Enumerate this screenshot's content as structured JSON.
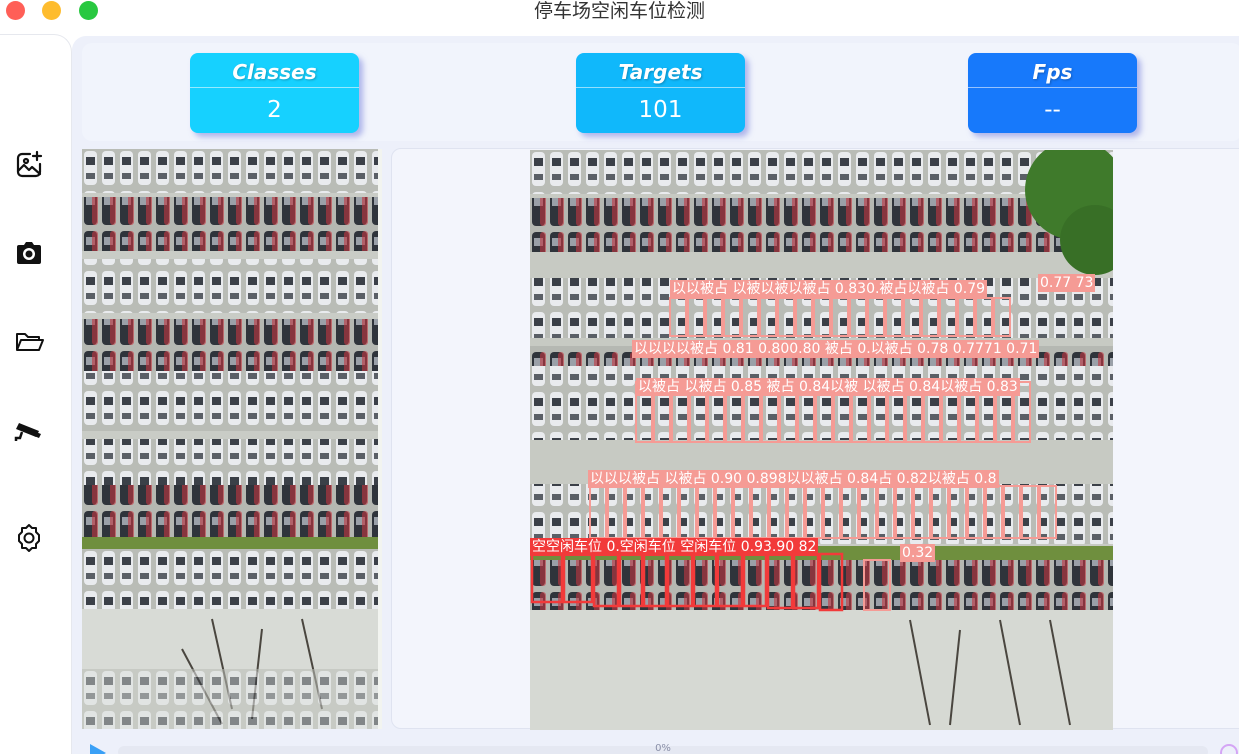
{
  "window": {
    "title": "停车场空闲车位检测"
  },
  "sidebar": {
    "items": [
      {
        "name": "add-image",
        "icon": "image-add-icon"
      },
      {
        "name": "camera",
        "icon": "camera-icon"
      },
      {
        "name": "open-folder",
        "icon": "folder-open-icon"
      },
      {
        "name": "webcam",
        "icon": "security-camera-icon"
      },
      {
        "name": "settings",
        "icon": "gear-icon"
      }
    ]
  },
  "stats": {
    "classes": {
      "label": "Classes",
      "value": "2"
    },
    "targets": {
      "label": "Targets",
      "value": "101"
    },
    "fps": {
      "label": "Fps",
      "value": "--"
    }
  },
  "detections": {
    "labels": [
      {
        "text": "以以被占 以被以被以被占 0.830.被占以被占 0.79",
        "kind": "occupied"
      },
      {
        "text": "0.77 73",
        "kind": "occupied"
      },
      {
        "text": "以以以以被占 0.81 0.800.80 被占 0.以被占 0.78 0.7771 0.71",
        "kind": "occupied"
      },
      {
        "text": "以被占 以被占 0.85 被占 0.84以被 以被占 0.84以被占 0.83",
        "kind": "occupied"
      },
      {
        "text": "以以以被占 以被占 0.90 0.898以以被占 0.84占 0.82以被占 0.8",
        "kind": "occupied"
      },
      {
        "text": "空空闲车位 0.空闲车位 空闲车位 0.93.90 82",
        "kind": "empty"
      },
      {
        "text": "0.32",
        "kind": "occupied"
      }
    ]
  },
  "playback": {
    "progress_text": "0%",
    "progress": 0
  },
  "colors": {
    "classes_card": "#16d1ff",
    "targets_card": "#10b8fb",
    "fps_card": "#1779fb",
    "occupied_box": "#f59b95",
    "empty_box": "#f23a3a"
  }
}
